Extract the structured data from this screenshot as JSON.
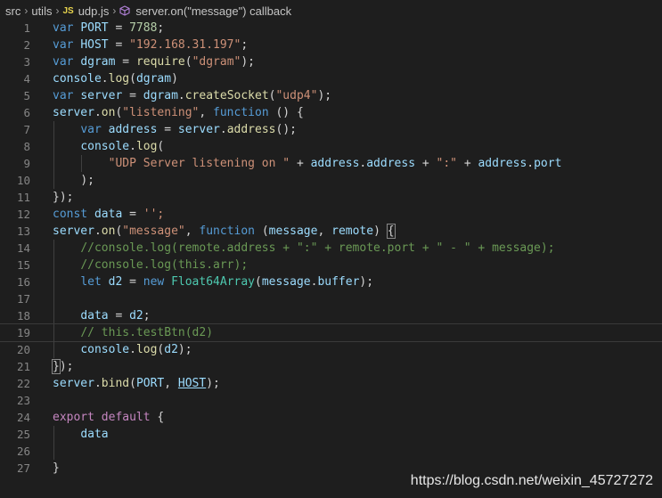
{
  "breadcrumb": {
    "items": [
      "src",
      "utils",
      "udp.js",
      "server.on(\"message\") callback"
    ],
    "file_badge": "JS"
  },
  "editor": {
    "lines": [
      {
        "n": "1",
        "tokens": [
          [
            "var",
            "kw"
          ],
          [
            " ",
            ""
          ],
          [
            "PORT",
            "var"
          ],
          [
            " = ",
            ""
          ],
          [
            "7788",
            "num"
          ],
          [
            ";",
            ""
          ]
        ]
      },
      {
        "n": "2",
        "tokens": [
          [
            "var",
            "kw"
          ],
          [
            " ",
            ""
          ],
          [
            "HOST",
            "var"
          ],
          [
            " = ",
            ""
          ],
          [
            "\"192.168.31.197\"",
            "str"
          ],
          [
            ";",
            ""
          ]
        ]
      },
      {
        "n": "3",
        "tokens": [
          [
            "var",
            "kw"
          ],
          [
            " ",
            ""
          ],
          [
            "dgram",
            "var"
          ],
          [
            " = ",
            ""
          ],
          [
            "require",
            "fn"
          ],
          [
            "(",
            ""
          ],
          [
            "\"dgram\"",
            "str"
          ],
          [
            ");",
            ""
          ]
        ]
      },
      {
        "n": "4",
        "tokens": [
          [
            "console",
            "var"
          ],
          [
            ".",
            ""
          ],
          [
            "log",
            "fn"
          ],
          [
            "(",
            ""
          ],
          [
            "dgram",
            "var"
          ],
          [
            ")",
            ""
          ]
        ]
      },
      {
        "n": "5",
        "tokens": [
          [
            "var",
            "kw"
          ],
          [
            " ",
            ""
          ],
          [
            "server",
            "var"
          ],
          [
            " = ",
            ""
          ],
          [
            "dgram",
            "var"
          ],
          [
            ".",
            ""
          ],
          [
            "createSocket",
            "fn"
          ],
          [
            "(",
            ""
          ],
          [
            "\"udp4\"",
            "str"
          ],
          [
            ");",
            ""
          ]
        ]
      },
      {
        "n": "6",
        "tokens": [
          [
            "server",
            "var"
          ],
          [
            ".",
            ""
          ],
          [
            "on",
            "fn"
          ],
          [
            "(",
            ""
          ],
          [
            "\"listening\"",
            "str"
          ],
          [
            ", ",
            ""
          ],
          [
            "function",
            "kw"
          ],
          [
            " () {",
            ""
          ]
        ]
      },
      {
        "n": "7",
        "tokens": [
          [
            "    ",
            ""
          ],
          [
            "var",
            "kw"
          ],
          [
            " ",
            ""
          ],
          [
            "address",
            "var"
          ],
          [
            " = ",
            ""
          ],
          [
            "server",
            "var"
          ],
          [
            ".",
            ""
          ],
          [
            "address",
            "fn"
          ],
          [
            "();",
            ""
          ]
        ]
      },
      {
        "n": "8",
        "tokens": [
          [
            "    ",
            ""
          ],
          [
            "console",
            "var"
          ],
          [
            ".",
            ""
          ],
          [
            "log",
            "fn"
          ],
          [
            "(",
            ""
          ]
        ]
      },
      {
        "n": "9",
        "tokens": [
          [
            "        ",
            ""
          ],
          [
            "\"UDP Server listening on \"",
            "str"
          ],
          [
            " + ",
            ""
          ],
          [
            "address",
            "var"
          ],
          [
            ".",
            ""
          ],
          [
            "address",
            "var"
          ],
          [
            " + ",
            ""
          ],
          [
            "\":\"",
            "str"
          ],
          [
            " + ",
            ""
          ],
          [
            "address",
            "var"
          ],
          [
            ".",
            ""
          ],
          [
            "port",
            "var"
          ]
        ]
      },
      {
        "n": "10",
        "tokens": [
          [
            "    ",
            ""
          ],
          [
            ");",
            ""
          ]
        ]
      },
      {
        "n": "11",
        "tokens": [
          [
            "});",
            ""
          ]
        ]
      },
      {
        "n": "12",
        "tokens": [
          [
            "const",
            "kw"
          ],
          [
            " ",
            ""
          ],
          [
            "data",
            "var"
          ],
          [
            " = ",
            ""
          ],
          [
            "'';",
            "str"
          ]
        ]
      },
      {
        "n": "13",
        "tokens": [
          [
            "server",
            "var"
          ],
          [
            ".",
            ""
          ],
          [
            "on",
            "fn"
          ],
          [
            "(",
            ""
          ],
          [
            "\"message\"",
            "str"
          ],
          [
            ", ",
            ""
          ],
          [
            "function",
            "kw"
          ],
          [
            " (",
            ""
          ],
          [
            "message",
            "var"
          ],
          [
            ", ",
            ""
          ],
          [
            "remote",
            "var"
          ],
          [
            ") ",
            ""
          ],
          [
            "{",
            "brk"
          ]
        ]
      },
      {
        "n": "14",
        "tokens": [
          [
            "    ",
            ""
          ],
          [
            "//console.log(remote.address + \":\" + remote.port + \" - \" + message);",
            "com"
          ]
        ]
      },
      {
        "n": "15",
        "tokens": [
          [
            "    ",
            ""
          ],
          [
            "//console.log(this.arr);",
            "com"
          ]
        ]
      },
      {
        "n": "16",
        "tokens": [
          [
            "    ",
            ""
          ],
          [
            "let",
            "kw"
          ],
          [
            " ",
            ""
          ],
          [
            "d2",
            "var"
          ],
          [
            " = ",
            ""
          ],
          [
            "new",
            "kw"
          ],
          [
            " ",
            ""
          ],
          [
            "Float64Array",
            "cls"
          ],
          [
            "(",
            ""
          ],
          [
            "message",
            "var"
          ],
          [
            ".",
            ""
          ],
          [
            "buffer",
            "var"
          ],
          [
            ");",
            ""
          ]
        ]
      },
      {
        "n": "17",
        "tokens": []
      },
      {
        "n": "18",
        "tokens": [
          [
            "    ",
            ""
          ],
          [
            "data",
            "var"
          ],
          [
            " = ",
            ""
          ],
          [
            "d2",
            "var"
          ],
          [
            ";",
            ""
          ]
        ]
      },
      {
        "n": "19",
        "tokens": [
          [
            "    ",
            ""
          ],
          [
            "// this.testBtn(d2)",
            "com"
          ]
        ]
      },
      {
        "n": "20",
        "tokens": [
          [
            "    ",
            ""
          ],
          [
            "console",
            "var"
          ],
          [
            ".",
            ""
          ],
          [
            "log",
            "fn"
          ],
          [
            "(",
            ""
          ],
          [
            "d2",
            "var"
          ],
          [
            ");",
            ""
          ]
        ]
      },
      {
        "n": "21",
        "tokens": [
          [
            "}",
            "brk"
          ],
          [
            ");",
            ""
          ]
        ]
      },
      {
        "n": "22",
        "tokens": [
          [
            "server",
            "var"
          ],
          [
            ".",
            ""
          ],
          [
            "bind",
            "fn"
          ],
          [
            "(",
            ""
          ],
          [
            "PORT",
            "var"
          ],
          [
            ", ",
            ""
          ],
          [
            "HOST",
            "host"
          ],
          [
            ");",
            ""
          ]
        ]
      },
      {
        "n": "23",
        "tokens": []
      },
      {
        "n": "24",
        "tokens": [
          [
            "export",
            "kw2"
          ],
          [
            " ",
            ""
          ],
          [
            "default",
            "kw2"
          ],
          [
            " {",
            ""
          ]
        ]
      },
      {
        "n": "25",
        "tokens": [
          [
            "    ",
            ""
          ],
          [
            "data",
            "var"
          ]
        ]
      },
      {
        "n": "26",
        "tokens": []
      },
      {
        "n": "27",
        "tokens": [
          [
            "}",
            ""
          ]
        ]
      }
    ]
  },
  "watermark": "https://blog.csdn.net/weixin_45727272"
}
